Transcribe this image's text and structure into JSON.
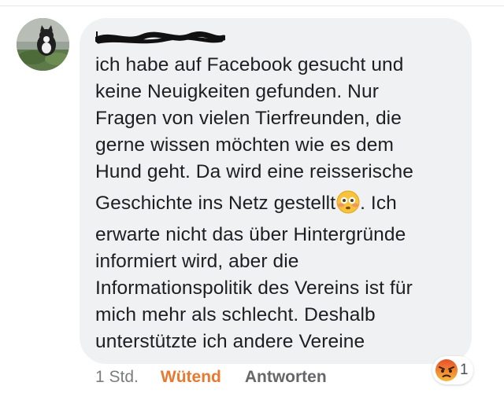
{
  "comment": {
    "lines": [
      "ich habe auf Facebook gesucht und",
      "keine Neuigkeiten gefunden. Nur",
      "Fragen von vielen Tierfreunden, die",
      "gerne wissen möchten wie es dem",
      "Hund geht. Da wird eine reisserische",
      "Geschichte ins Netz gestellt",
      ". Ich",
      "erwarte nicht das über Hintergründe",
      "informiert wird, aber die",
      "Informationspolitik des Vereins ist für",
      "mich mehr als schlecht. Deshalb",
      "unterstützte ich andere Vereine"
    ]
  },
  "actions": {
    "time": "1 Std.",
    "reaction_label": "Wütend",
    "reply_label": "Antworten"
  },
  "reaction_badge": {
    "icon": "angry-face-icon",
    "count": "1"
  },
  "icons": {
    "inline_emoji": "flushed-face-icon"
  },
  "colors": {
    "bubble": "#f0f1f3",
    "text": "#1c1e21",
    "reaction_label": "#e8792f",
    "secondary": "#65676b"
  }
}
